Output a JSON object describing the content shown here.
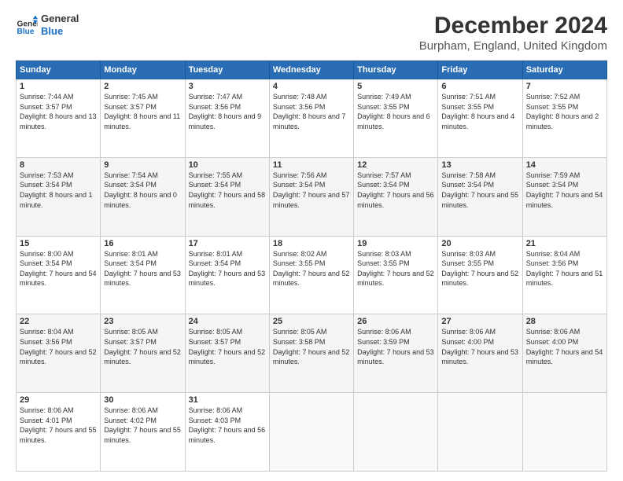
{
  "logo": {
    "line1": "General",
    "line2": "Blue"
  },
  "title": "December 2024",
  "subtitle": "Burpham, England, United Kingdom",
  "days_header": [
    "Sunday",
    "Monday",
    "Tuesday",
    "Wednesday",
    "Thursday",
    "Friday",
    "Saturday"
  ],
  "weeks": [
    [
      {
        "num": "1",
        "sunrise": "7:44 AM",
        "sunset": "3:57 PM",
        "daylight": "8 hours and 13 minutes."
      },
      {
        "num": "2",
        "sunrise": "7:45 AM",
        "sunset": "3:57 PM",
        "daylight": "8 hours and 11 minutes."
      },
      {
        "num": "3",
        "sunrise": "7:47 AM",
        "sunset": "3:56 PM",
        "daylight": "8 hours and 9 minutes."
      },
      {
        "num": "4",
        "sunrise": "7:48 AM",
        "sunset": "3:56 PM",
        "daylight": "8 hours and 7 minutes."
      },
      {
        "num": "5",
        "sunrise": "7:49 AM",
        "sunset": "3:55 PM",
        "daylight": "8 hours and 6 minutes."
      },
      {
        "num": "6",
        "sunrise": "7:51 AM",
        "sunset": "3:55 PM",
        "daylight": "8 hours and 4 minutes."
      },
      {
        "num": "7",
        "sunrise": "7:52 AM",
        "sunset": "3:55 PM",
        "daylight": "8 hours and 2 minutes."
      }
    ],
    [
      {
        "num": "8",
        "sunrise": "7:53 AM",
        "sunset": "3:54 PM",
        "daylight": "8 hours and 1 minute."
      },
      {
        "num": "9",
        "sunrise": "7:54 AM",
        "sunset": "3:54 PM",
        "daylight": "8 hours and 0 minutes."
      },
      {
        "num": "10",
        "sunrise": "7:55 AM",
        "sunset": "3:54 PM",
        "daylight": "7 hours and 58 minutes."
      },
      {
        "num": "11",
        "sunrise": "7:56 AM",
        "sunset": "3:54 PM",
        "daylight": "7 hours and 57 minutes."
      },
      {
        "num": "12",
        "sunrise": "7:57 AM",
        "sunset": "3:54 PM",
        "daylight": "7 hours and 56 minutes."
      },
      {
        "num": "13",
        "sunrise": "7:58 AM",
        "sunset": "3:54 PM",
        "daylight": "7 hours and 55 minutes."
      },
      {
        "num": "14",
        "sunrise": "7:59 AM",
        "sunset": "3:54 PM",
        "daylight": "7 hours and 54 minutes."
      }
    ],
    [
      {
        "num": "15",
        "sunrise": "8:00 AM",
        "sunset": "3:54 PM",
        "daylight": "7 hours and 54 minutes."
      },
      {
        "num": "16",
        "sunrise": "8:01 AM",
        "sunset": "3:54 PM",
        "daylight": "7 hours and 53 minutes."
      },
      {
        "num": "17",
        "sunrise": "8:01 AM",
        "sunset": "3:54 PM",
        "daylight": "7 hours and 53 minutes."
      },
      {
        "num": "18",
        "sunrise": "8:02 AM",
        "sunset": "3:55 PM",
        "daylight": "7 hours and 52 minutes."
      },
      {
        "num": "19",
        "sunrise": "8:03 AM",
        "sunset": "3:55 PM",
        "daylight": "7 hours and 52 minutes."
      },
      {
        "num": "20",
        "sunrise": "8:03 AM",
        "sunset": "3:55 PM",
        "daylight": "7 hours and 52 minutes."
      },
      {
        "num": "21",
        "sunrise": "8:04 AM",
        "sunset": "3:56 PM",
        "daylight": "7 hours and 51 minutes."
      }
    ],
    [
      {
        "num": "22",
        "sunrise": "8:04 AM",
        "sunset": "3:56 PM",
        "daylight": "7 hours and 52 minutes."
      },
      {
        "num": "23",
        "sunrise": "8:05 AM",
        "sunset": "3:57 PM",
        "daylight": "7 hours and 52 minutes."
      },
      {
        "num": "24",
        "sunrise": "8:05 AM",
        "sunset": "3:57 PM",
        "daylight": "7 hours and 52 minutes."
      },
      {
        "num": "25",
        "sunrise": "8:05 AM",
        "sunset": "3:58 PM",
        "daylight": "7 hours and 52 minutes."
      },
      {
        "num": "26",
        "sunrise": "8:06 AM",
        "sunset": "3:59 PM",
        "daylight": "7 hours and 53 minutes."
      },
      {
        "num": "27",
        "sunrise": "8:06 AM",
        "sunset": "4:00 PM",
        "daylight": "7 hours and 53 minutes."
      },
      {
        "num": "28",
        "sunrise": "8:06 AM",
        "sunset": "4:00 PM",
        "daylight": "7 hours and 54 minutes."
      }
    ],
    [
      {
        "num": "29",
        "sunrise": "8:06 AM",
        "sunset": "4:01 PM",
        "daylight": "7 hours and 55 minutes."
      },
      {
        "num": "30",
        "sunrise": "8:06 AM",
        "sunset": "4:02 PM",
        "daylight": "7 hours and 55 minutes."
      },
      {
        "num": "31",
        "sunrise": "8:06 AM",
        "sunset": "4:03 PM",
        "daylight": "7 hours and 56 minutes."
      },
      null,
      null,
      null,
      null
    ]
  ]
}
